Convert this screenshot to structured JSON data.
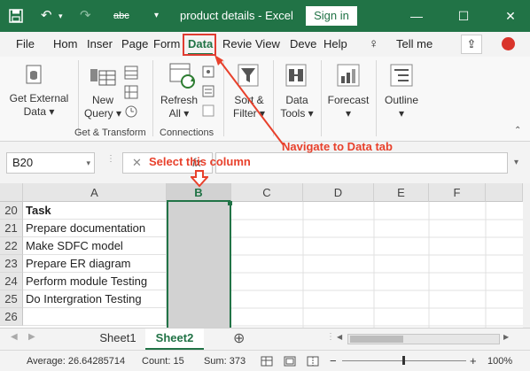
{
  "titlebar": {
    "undo_glyph": "↶",
    "redo_glyph": "↷",
    "spelling_label": "abc",
    "title": "product details  -  Excel",
    "signin_label": "Sign in",
    "min_glyph": "—",
    "max_glyph": "☐",
    "close_glyph": "✕"
  },
  "tabs": [
    "File",
    "Hom",
    "Inser",
    "Page",
    "Form",
    "Data",
    "Revie",
    "View",
    "Deve",
    "Help"
  ],
  "active_tab": "Data",
  "tell_me": "Tell me",
  "ribbon": {
    "get_external_data": [
      "Get External",
      "Data ▾"
    ],
    "new_query": [
      "New",
      "Query ▾"
    ],
    "group1_label": "Get & Transform",
    "refresh": [
      "Refresh",
      "All ▾"
    ],
    "group2_label": "Connections",
    "sort_filter": [
      "Sort &",
      "Filter ▾"
    ],
    "data_tools": [
      "Data",
      "Tools ▾"
    ],
    "forecast": [
      "Forecast",
      "▾"
    ],
    "outline": [
      "Outline",
      "▾"
    ]
  },
  "formula_bar": {
    "name_box": "B20",
    "cancel_glyph": "✕",
    "fx_glyph": "fx"
  },
  "columns": [
    "A",
    "B",
    "C",
    "D",
    "E",
    "F"
  ],
  "rows": [
    {
      "num": "20",
      "a": "Task"
    },
    {
      "num": "21",
      "a": "Prepare documentation"
    },
    {
      "num": "22",
      "a": "Make SDFC model"
    },
    {
      "num": "23",
      "a": "Prepare ER diagram"
    },
    {
      "num": "24",
      "a": "Perform module Testing"
    },
    {
      "num": "25",
      "a": "Do Intergration Testing"
    },
    {
      "num": "26",
      "a": ""
    }
  ],
  "sheets": [
    "Sheet1",
    "Sheet2"
  ],
  "active_sheet": "Sheet2",
  "add_sheet_glyph": "⊕",
  "status": {
    "average": "Average: 26.64285714",
    "count": "Count: 15",
    "sum": "Sum: 373",
    "zoom": "100%",
    "zoom_minus": "−",
    "zoom_plus": "+"
  },
  "annotations": {
    "select_column": "Select this column",
    "navigate": "Navigate to Data tab"
  },
  "colors": {
    "excel_green": "#217346",
    "annotation_red": "#e8412c"
  }
}
